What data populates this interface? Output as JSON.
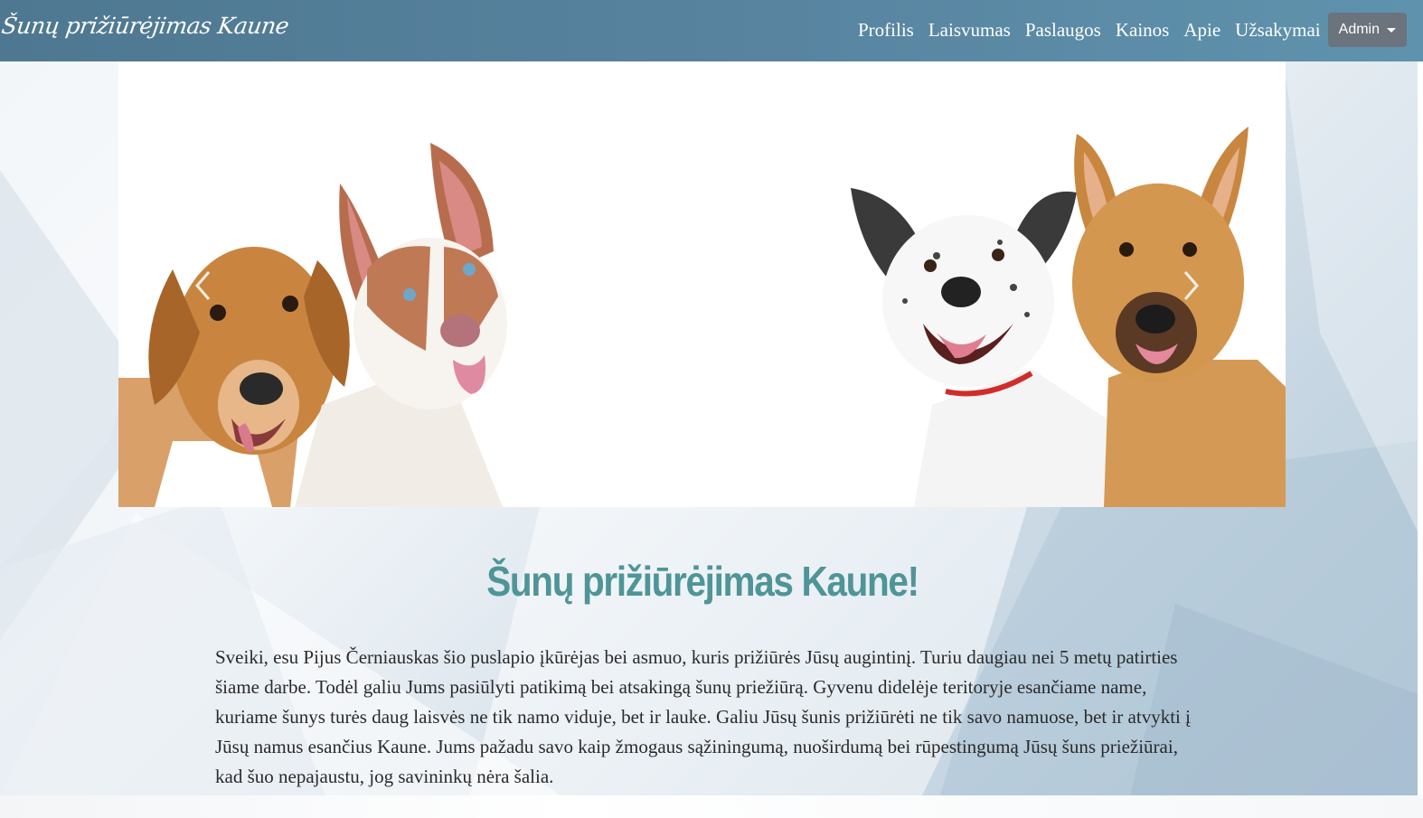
{
  "navbar": {
    "brand": "Šunų prižiūrėjimas Kaune",
    "links": [
      "Profilis",
      "Laisvumas",
      "Paslaugos",
      "Kainos",
      "Apie",
      "Užsakymai"
    ],
    "admin_label": "Admin"
  },
  "carousel": {
    "prev_icon": "chevron-left-icon",
    "next_icon": "chevron-right-icon"
  },
  "main": {
    "heading": "Šunų prižiūrėjimas Kaune!",
    "intro": "Sveiki, esu Pijus Černiauskas šio puslapio įkūrėjas bei asmuo, kuris prižiūrės Jūsų augintinį. Turiu daugiau nei 5 metų patirties šiame darbe. Todėl galiu Jums pasiūlyti patikimą bei atsakingą šunų priežiūrą. Gyvenu didelėje teritoryje esančiame name, kuriame šunys turės daug laisvės ne tik namo viduje, bet ir lauke. Galiu Jūsų šunis prižiūrėti ne tik savo namuose, bet ir atvykti į Jūsų namus esančius Kaune. Jums pažadu savo kaip žmogaus sąžiningumą, nuoširdumą bei rūpestingumą Jūsų šuns priežiūrai, kad šuo nepajaustu, jog savininkų nėra šalia."
  },
  "colors": {
    "navbar": "#5884a0",
    "heading": "#4f9597",
    "admin_button": "#6b737c"
  }
}
